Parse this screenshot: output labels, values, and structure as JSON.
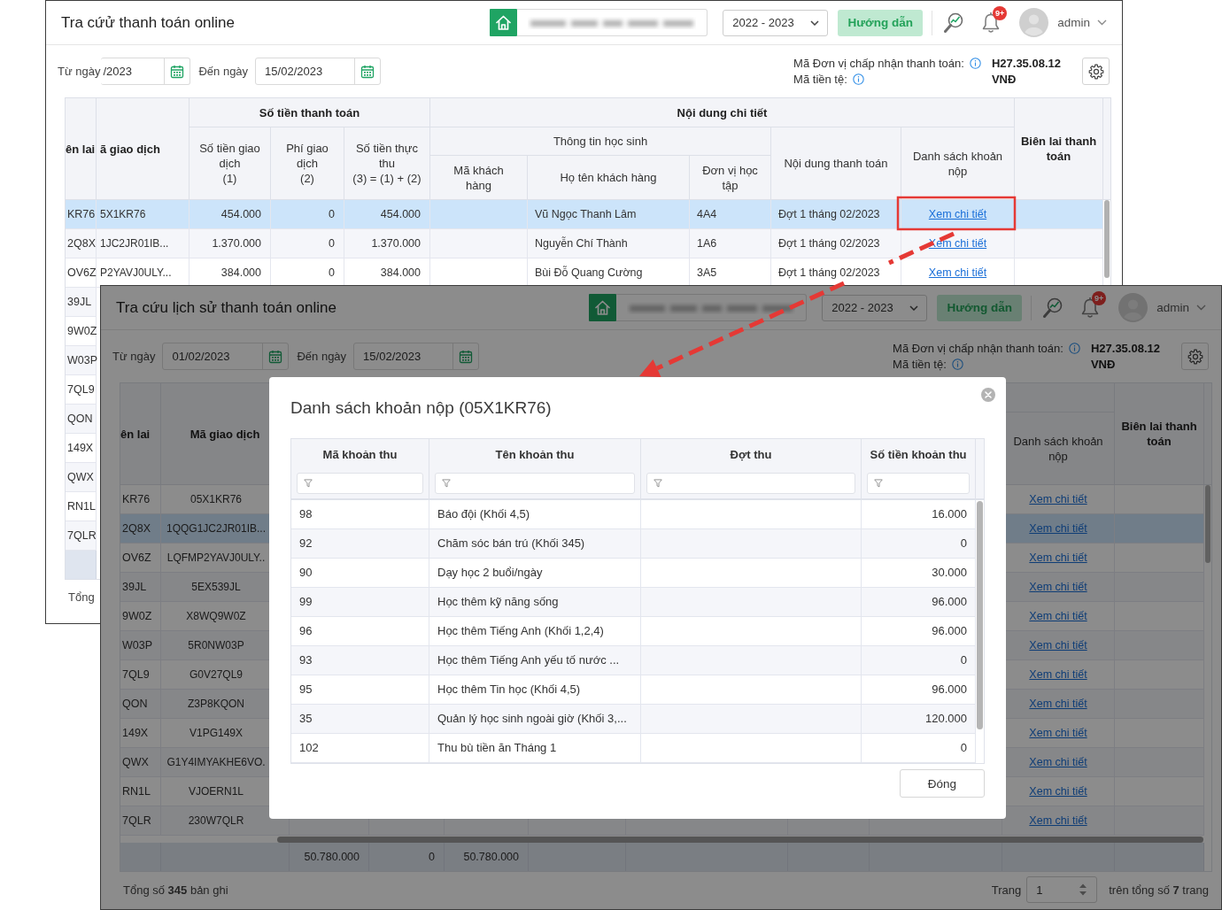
{
  "back_window": {
    "title": "Tra cứử thanh toán online",
    "school_year": "2022 - 2023",
    "help_button": "Hướng dẫn",
    "notification_count": "9+",
    "user_name": "admin",
    "date_from": {
      "label": "Từ ngày",
      "value": "/2023"
    },
    "date_to": {
      "label": "Đến ngày",
      "value": "15/02/2023"
    },
    "merchant_code": {
      "label": "Mã Đơn vị chấp nhận thanh toán:",
      "value": "H27.35.08.12"
    },
    "currency": {
      "label": "Mã tiền tệ:",
      "value": "VNĐ"
    },
    "table": {
      "groups": {
        "payment": "Số tiền thanh toán",
        "details": "Nội dung chi tiết",
        "student_info": "Thông tin học sinh"
      },
      "columns": {
        "column_1": {
          "label": "ên lai"
        },
        "transaction_code": {
          "label": "ã giao dịch"
        },
        "amount": {
          "label": "Số tiền giao dịch",
          "formula": "(1)"
        },
        "fee": {
          "label": "Phí giao dịch",
          "formula": "(2)"
        },
        "net_amount": {
          "label": "Số tiền thực thu",
          "formula": "(3) = (1) + (2)"
        },
        "customer_code": {
          "label": "Mã khách hàng"
        },
        "customer_name": {
          "label": "Họ tên khách hàng"
        },
        "class": {
          "label": "Đơn vị học tập"
        },
        "payment_content": {
          "label": "Nội dung thanh toán"
        },
        "fee_list": {
          "label": "Danh sách khoản nộp"
        },
        "receipt": {
          "label": "Biên lai thanh toán"
        }
      },
      "rows": [
        {
          "selected": true,
          "column_1": "KR76",
          "transaction_code": "5X1KR76",
          "amount": "454.000",
          "fee": "0",
          "net_amount": "454.000",
          "customer_name": "Vũ Ngọc Thanh Lâm",
          "class": "4A4",
          "payment_content": "Đợt 1 tháng 02/2023",
          "fee_list": "Xem chi tiết"
        },
        {
          "selected": false,
          "column_1": "2Q8X",
          "transaction_code": "1JC2JR01IB...",
          "amount": "1.370.000",
          "fee": "0",
          "net_amount": "1.370.000",
          "customer_name": "Nguyễn Chí Thành",
          "class": "1A6",
          "payment_content": "Đợt 1 tháng 02/2023",
          "fee_list": "Xem chi tiết"
        },
        {
          "selected": false,
          "column_1": "OV6Z",
          "transaction_code": "P2YAVJ0ULY...",
          "amount": "384.000",
          "fee": "0",
          "net_amount": "384.000",
          "customer_name": "Bùi Đỗ Quang Cường",
          "class": "3A5",
          "payment_content": "Đợt 1 tháng 02/2023",
          "fee_list": "Xem chi tiết"
        },
        {
          "selected": false,
          "column_1": "39JL"
        },
        {
          "selected": false,
          "column_1": "9W0Z"
        },
        {
          "selected": false,
          "column_1": "W03P"
        },
        {
          "selected": false,
          "column_1": "7QL9"
        },
        {
          "selected": false,
          "column_1": "QON"
        },
        {
          "selected": false,
          "column_1": "149X"
        },
        {
          "selected": false,
          "column_1": "QWX"
        },
        {
          "selected": false,
          "column_1": "RN1L"
        },
        {
          "selected": false,
          "column_1": "7QLR"
        }
      ]
    },
    "footer": {
      "summary": "Tổng"
    }
  },
  "front_window": {
    "title": "Tra cứu lịch sử thanh toán online",
    "school_year": "2022 - 2023",
    "help_button": "Hướng dẫn",
    "notification_count": "9+",
    "user_name": "admin",
    "date_from": {
      "label": "Từ ngày",
      "value": "01/02/2023"
    },
    "date_to": {
      "label": "Đến ngày",
      "value": "15/02/2023"
    },
    "merchant_code": {
      "label": "Mã Đơn vị chấp nhận thanh toán:",
      "value": "H27.35.08.12"
    },
    "currency": {
      "label": "Mã tiền tệ:",
      "value": "VNĐ"
    },
    "table": {
      "columns": {
        "column_1": {
          "label": "ên lai"
        },
        "transaction_code": {
          "label": "Mã giao dịch"
        },
        "fee_list": {
          "label": "Danh sách khoản nộp"
        },
        "receipt": {
          "label": "Biên lai thanh toán"
        }
      },
      "rows": [
        {
          "selected": false,
          "column_1": "KR76",
          "transaction_code": "05X1KR76",
          "fee_list": "Xem chi tiết"
        },
        {
          "selected": true,
          "column_1": "2Q8X",
          "transaction_code": "1QQG1JC2JR01IB...",
          "fee_list": "Xem chi tiết"
        },
        {
          "selected": false,
          "column_1": "OV6Z",
          "transaction_code": "LQFMP2YAVJ0ULY..",
          "fee_list": "Xem chi tiết"
        },
        {
          "selected": false,
          "column_1": "39JL",
          "transaction_code": "5EX539JL",
          "fee_list": "Xem chi tiết"
        },
        {
          "selected": false,
          "column_1": "9W0Z",
          "transaction_code": "X8WQ9W0Z",
          "fee_list": "Xem chi tiết"
        },
        {
          "selected": false,
          "column_1": "W03P",
          "transaction_code": "5R0NW03P",
          "fee_list": "Xem chi tiết"
        },
        {
          "selected": false,
          "column_1": "7QL9",
          "transaction_code": "G0V27QL9",
          "fee_list": "Xem chi tiết"
        },
        {
          "selected": false,
          "column_1": "QON",
          "transaction_code": "Z3P8KQON",
          "fee_list": "Xem chi tiết"
        },
        {
          "selected": false,
          "column_1": "149X",
          "transaction_code": "V1PG149X",
          "fee_list": "Xem chi tiết"
        },
        {
          "selected": false,
          "column_1": "QWX",
          "transaction_code": "G1Y4IMYAKHE6VO.",
          "fee_list": "Xem chi tiết"
        },
        {
          "selected": false,
          "column_1": "RN1L",
          "transaction_code": "VJOERN1L",
          "fee_list": "Xem chi tiết"
        },
        {
          "selected": false,
          "column_1": "7QLR",
          "transaction_code": "230W7QLR",
          "fee_list": "Xem chi tiết"
        }
      ],
      "totals": {
        "amount": "50.780.000",
        "fee": "0",
        "net_amount": "50.780.000"
      }
    },
    "footer": {
      "summary": "Tổng số **345** bản ghi",
      "page_label": "Trang",
      "page": "1",
      "page_total": "trên tổng số **7** trang"
    },
    "fee_modal": {
      "title": "Danh sách khoản nộp (05X1KR76)",
      "columns": [
        "Mã khoản thu",
        "Tên khoản thu",
        "Đợt thu",
        "Số tiền khoản thu"
      ],
      "rows": [
        {
          "code": "98",
          "name": "Báo đội (Khối 4,5)",
          "amount": "16.000"
        },
        {
          "code": "92",
          "name": "Chăm sóc bán trú (Khối 345)",
          "amount": "0"
        },
        {
          "code": "90",
          "name": "Dạy học 2 buổi/ngày",
          "amount": "30.000"
        },
        {
          "code": "99",
          "name": "Học thêm kỹ năng sống",
          "amount": "96.000"
        },
        {
          "code": "96",
          "name": "Học thêm Tiếng Anh (Khối 1,2,4)",
          "amount": "96.000"
        },
        {
          "code": "93",
          "name": "Học thêm Tiếng Anh yếu tố nước ...",
          "amount": "0"
        },
        {
          "code": "95",
          "name": "Học thêm Tin học (Khối 4,5)",
          "amount": "96.000"
        },
        {
          "code": "35",
          "name": "Quản lý học sinh ngoài giờ (Khối 3,...",
          "amount": "120.000"
        },
        {
          "code": "102",
          "name": "Thu bù tiền ăn Tháng 1",
          "amount": "0"
        }
      ],
      "close_button": "Đóng"
    }
  }
}
